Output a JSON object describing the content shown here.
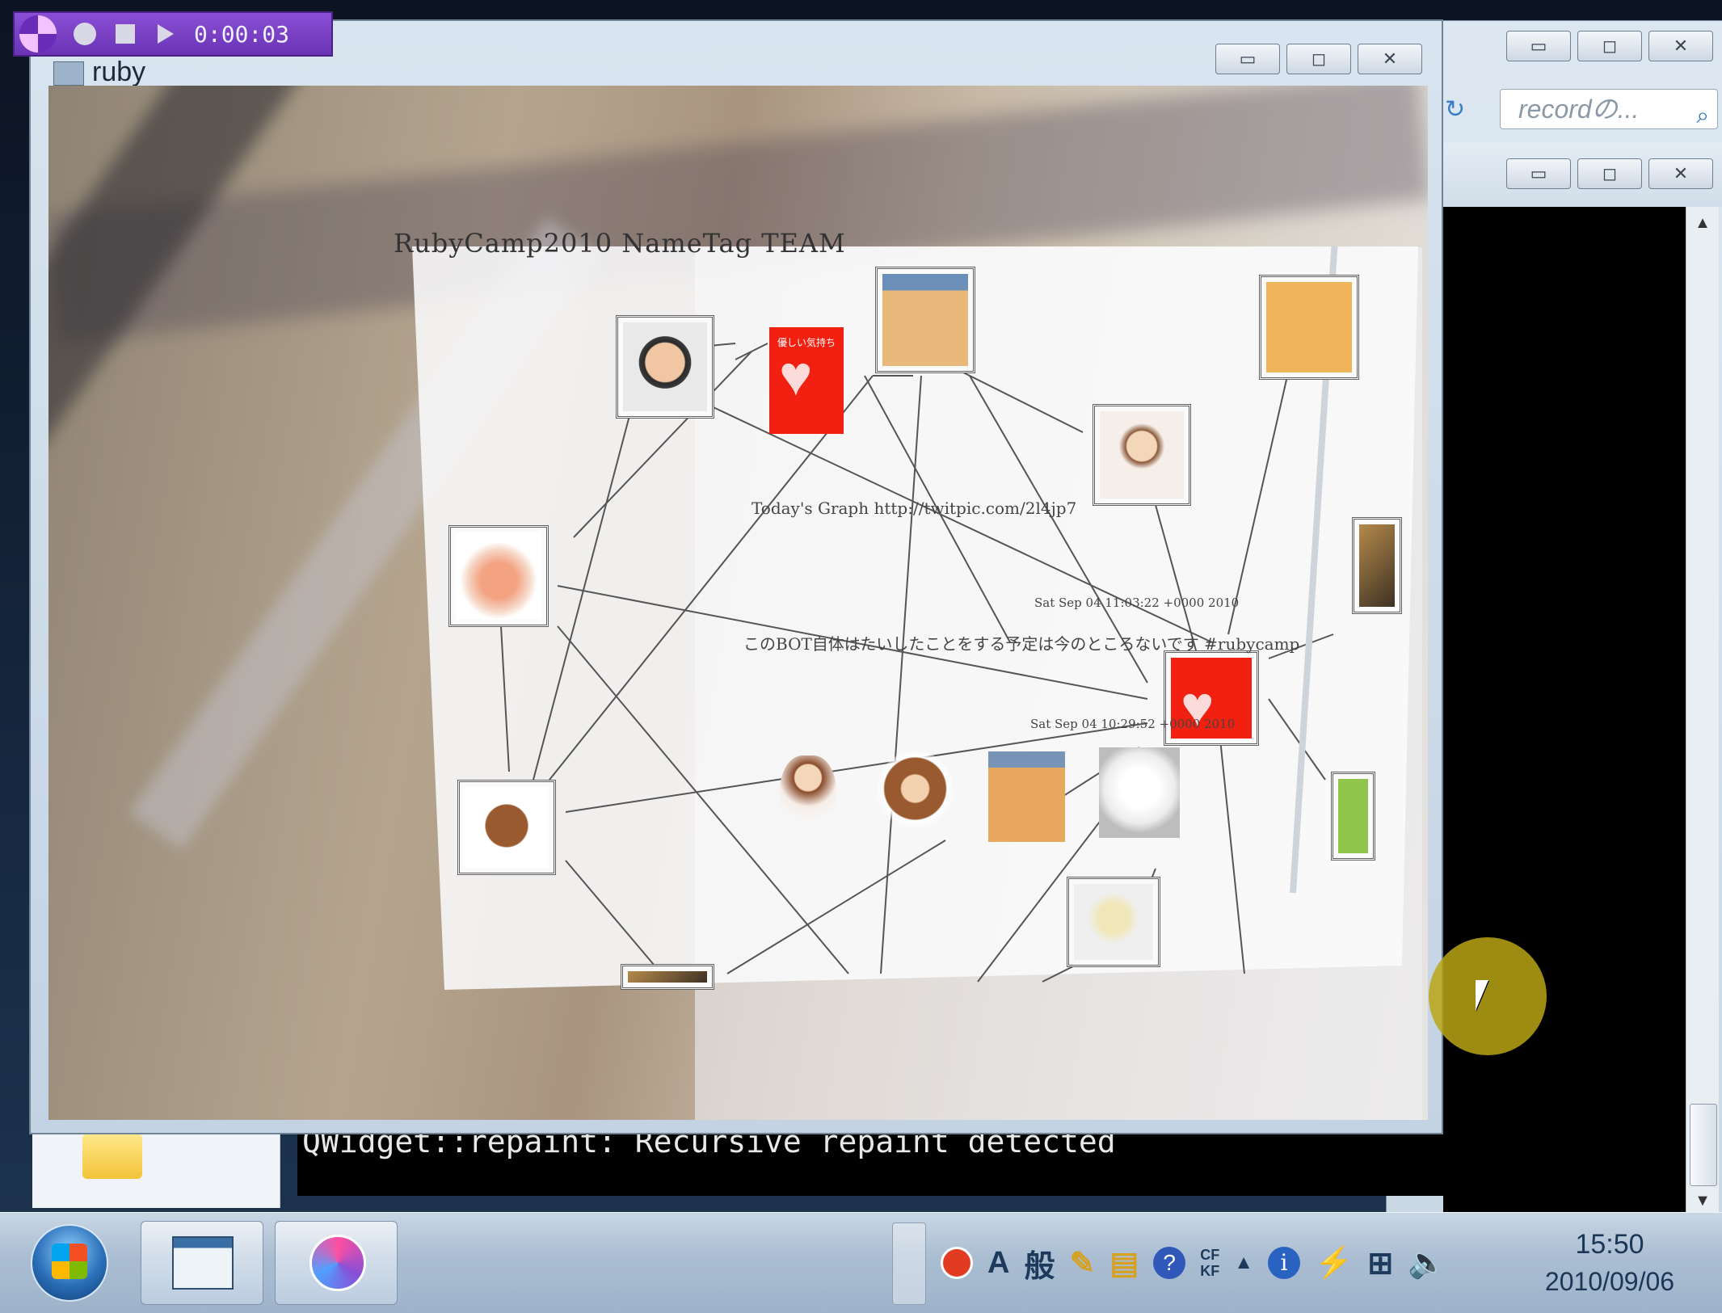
{
  "recorder": {
    "timer": "0:00:03"
  },
  "background_window": {
    "search_placeholder": "recordの..."
  },
  "front_window": {
    "title": "ruby",
    "ar_panel": {
      "title": "RubyCamp2010 NameTag TEAM",
      "graph_link": "Today's Graph http://twitpic.com/2l4jp7",
      "timestamp_1": "Sat Sep 04 11:03:22 +0000 2010",
      "tweet": "このBOT自体はたいしたことをする予定は今のところないです #rubycamp",
      "timestamp_2": "Sat Sep 04 10:29:52 +0000 2010",
      "heart_caption": "優しい気持ち"
    }
  },
  "console": {
    "text": "QWidget::repaint: Recursive repaint detected"
  },
  "taskbar": {
    "ime_mode": "A",
    "ime_kanji": "般",
    "tray_small_1": "CF",
    "tray_small_2": "KF",
    "clock_time": "15:50",
    "clock_date": "2010/09/06"
  },
  "icons": [
    "start-orb",
    "explorer-window",
    "recorder-gauge",
    "tray-red",
    "help",
    "info",
    "power",
    "network",
    "volume",
    "cursor"
  ],
  "colors": {
    "recorder_bg": "#7a40c6",
    "cursor_highlight": "#b9a514",
    "console_bg": "#000000"
  }
}
